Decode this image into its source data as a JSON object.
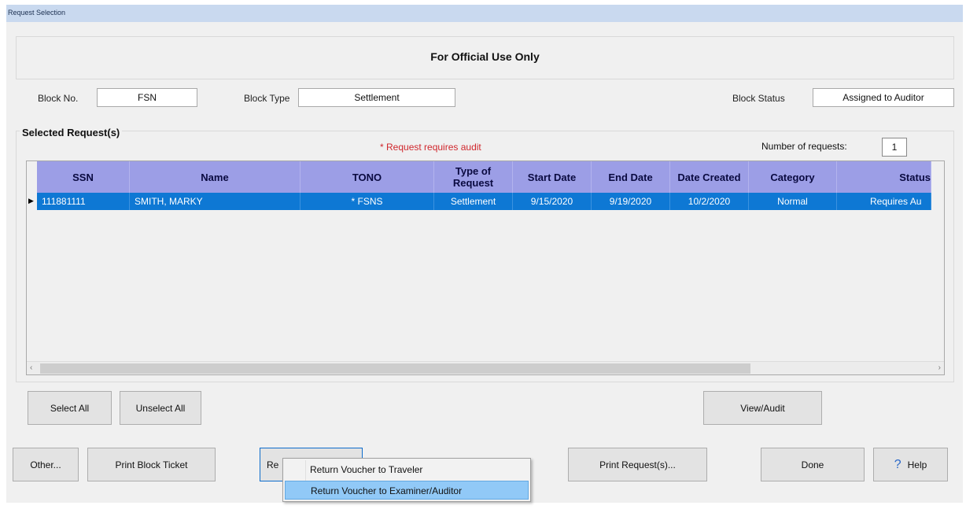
{
  "window": {
    "title": "Request Selection"
  },
  "banner": {
    "text": "For Official Use Only"
  },
  "fields": {
    "block_no": {
      "label": "Block No.",
      "value": "FSN"
    },
    "block_type": {
      "label": "Block Type",
      "value": "Settlement"
    },
    "block_status": {
      "label": "Block Status",
      "value": "Assigned to Auditor"
    }
  },
  "selected": {
    "title": "Selected Request(s)",
    "audit_note": "* Request requires audit",
    "num_requests_label": "Number of requests:",
    "num_requests_value": "1"
  },
  "grid": {
    "columns": [
      "SSN",
      "Name",
      "TONO",
      "Type of Request",
      "Start Date",
      "End Date",
      "Date Created",
      "Category",
      "Status"
    ],
    "rows": [
      [
        "111881111",
        "SMITH, MARKY",
        "* FSNS",
        "Settlement",
        "9/15/2020",
        "9/19/2020",
        "10/2/2020",
        "Normal",
        "Requires Au"
      ]
    ]
  },
  "buttons": {
    "select_all": "Select All",
    "unselect_all": "Unselect All",
    "view_audit": "View/Audit",
    "other": "Other...",
    "print_block_ticket": "Print Block Ticket",
    "return_partial": "Re",
    "print_requests": "Print Request(s)...",
    "done": "Done",
    "help": "Help"
  },
  "context_menu": {
    "items": [
      "Return Voucher to Traveler",
      "Return Voucher to Examiner/Auditor"
    ],
    "highlighted_index": 1
  },
  "icons": {
    "help": "question-mark-icon",
    "row_indicator": "triangle-right-icon",
    "scroll_left": "chevron-left-icon",
    "scroll_right": "chevron-right-icon"
  },
  "colors": {
    "title_bar": "#c9d9ef",
    "grid_header": "#9c9ee6",
    "selected_row": "#0e78d4",
    "audit_note": "#d0272d",
    "menu_highlight": "#91c9f7"
  }
}
